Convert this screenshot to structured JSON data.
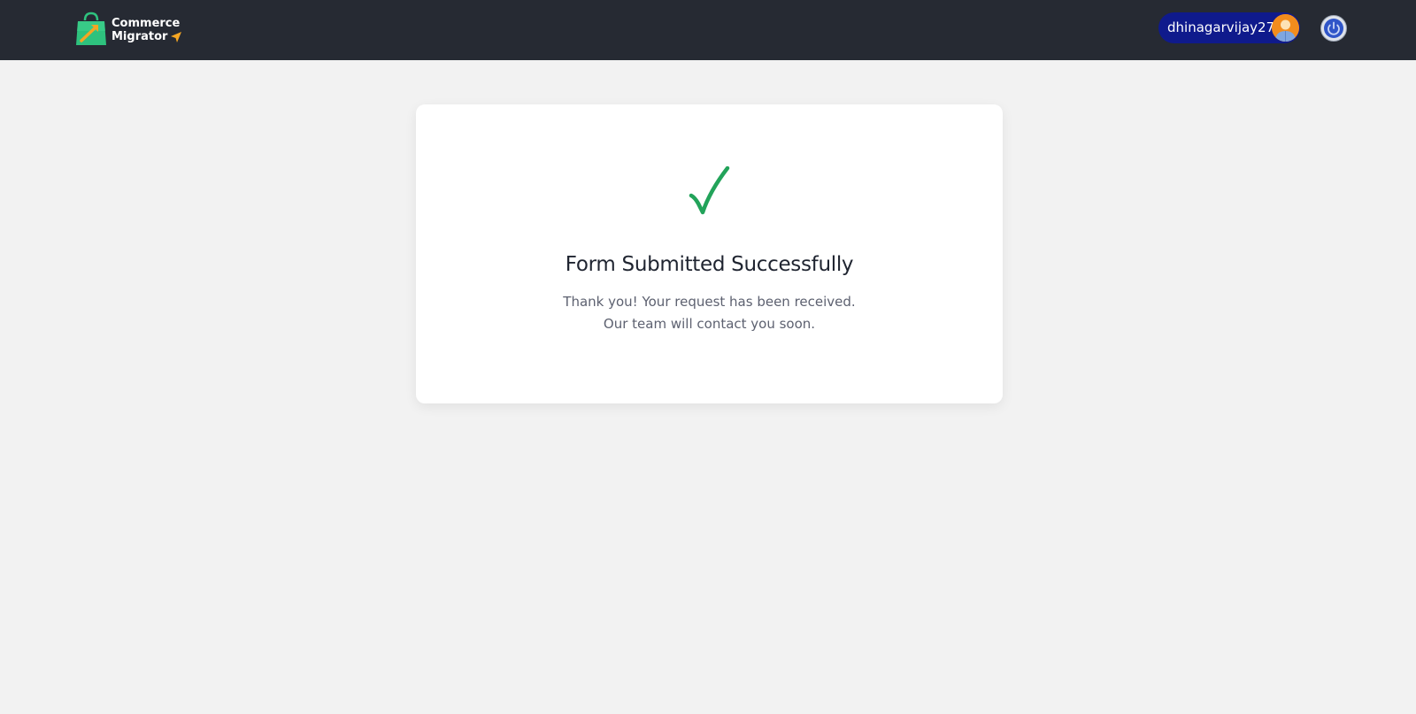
{
  "header": {
    "logo": {
      "line1": "Commerce",
      "line2": "Migrator"
    },
    "user": {
      "username": "dhinagarvijay27"
    },
    "icons": {
      "logo": "shopping-bag-icon",
      "avatar": "user-avatar-icon",
      "power": "power-icon"
    },
    "colors": {
      "bar_bg": "#262a33",
      "user_pill_bg": "#0f1a8c",
      "logo_green": "#2ec27e",
      "accent_orange": "#f5a623"
    }
  },
  "confirmation": {
    "title": "Form Submitted Successfully",
    "message_line1": "Thank you! Your request has been received.",
    "message_line2": "Our team will contact you soon.",
    "icon": "checkmark-icon",
    "icon_color": "#22a35a"
  }
}
